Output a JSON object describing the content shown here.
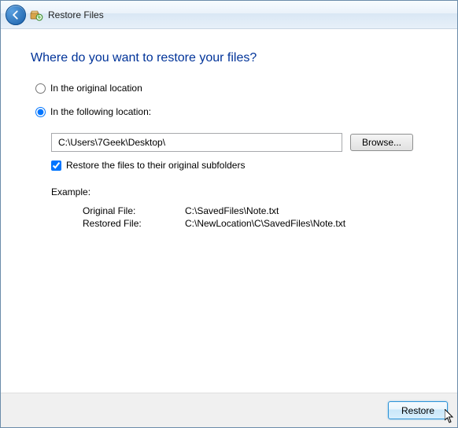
{
  "titlebar": {
    "title": "Restore Files"
  },
  "heading": "Where do you want to restore your files?",
  "options": {
    "original": {
      "label": "In the original location",
      "selected": false
    },
    "following": {
      "label": "In the following location:",
      "selected": true
    }
  },
  "path": {
    "value": "C:\\Users\\7Geek\\Desktop\\",
    "browse_label": "Browse..."
  },
  "subfolders": {
    "label": "Restore the files to their original subfolders",
    "checked": true
  },
  "example": {
    "heading": "Example:",
    "original_label": "Original File:",
    "original_value": "C:\\SavedFiles\\Note.txt",
    "restored_label": "Restored File:",
    "restored_value": "C:\\NewLocation\\C\\SavedFiles\\Note.txt"
  },
  "footer": {
    "restore_label": "Restore"
  }
}
